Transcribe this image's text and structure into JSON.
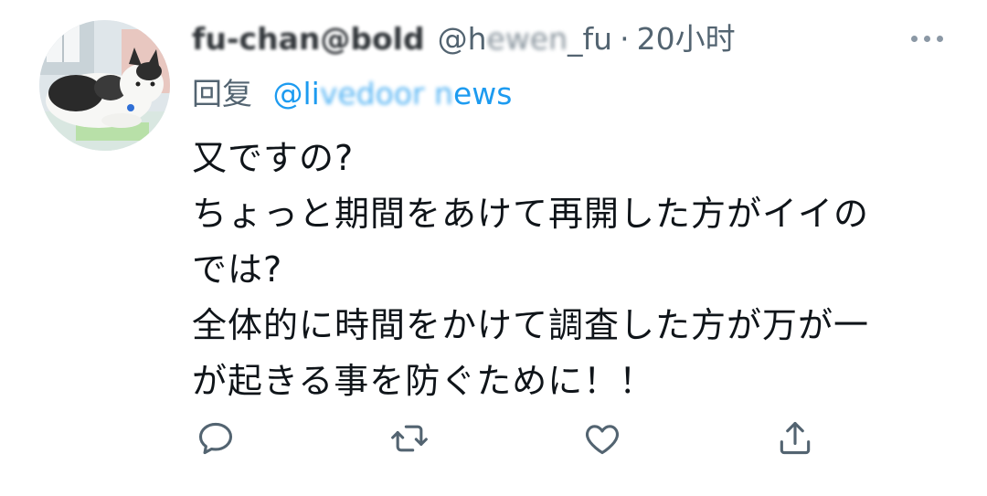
{
  "tweet": {
    "display_name": "fu-chan@bold",
    "handle_prefix": "@h",
    "handle_hidden": "ewen",
    "handle_suffix": "_fu",
    "separator": "·",
    "time": "20小时",
    "reply_label": "回复",
    "reply_handle_prefix": "@li",
    "reply_handle_hidden": "vedoor n",
    "reply_handle_suffix": "ews",
    "body_lines": [
      "又ですの?",
      "ちょっと期間をあけて再開した方がイイの",
      "では?",
      "全体的に時間をかけて調査した方が万が一",
      "が起きる事を防ぐために！！"
    ]
  },
  "actions": {
    "reply_icon": "comment-icon",
    "retweet_icon": "retweet-icon",
    "like_icon": "heart-icon",
    "share_icon": "share-icon"
  },
  "colors": {
    "text": "#0f1419",
    "secondary": "#536471",
    "link": "#1d9bf0",
    "icon": "#536471"
  }
}
